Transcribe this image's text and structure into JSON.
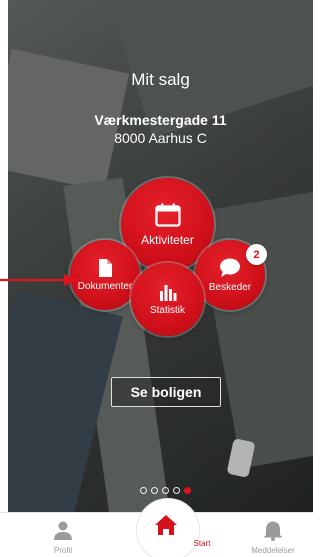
{
  "header": {
    "title": "Mit salg",
    "address": "Værkmestergade 11",
    "city": "8000 Aarhus C"
  },
  "menu": {
    "aktiviteter": {
      "label": "Aktiviteter",
      "icon": "calendar-icon"
    },
    "dokumenter": {
      "label": "Dokumenter",
      "icon": "document-icon"
    },
    "statistik": {
      "label": "Statistik",
      "icon": "bar-chart-icon"
    },
    "beskeder": {
      "label": "Beskeder",
      "icon": "chat-bubble-icon",
      "badge": "2"
    }
  },
  "see_button": {
    "label": "Se boligen"
  },
  "pager": {
    "count": 5,
    "active_index": 4
  },
  "tabbar": {
    "profil": {
      "label": "Profil",
      "icon": "person-icon"
    },
    "start": {
      "label": "Start",
      "icon": "home-icon"
    },
    "meddelelser": {
      "label": "Meddelelser",
      "icon": "bell-icon"
    }
  },
  "colors": {
    "brand_red": "#d5121b",
    "annotation_arrow": "#e0141d",
    "tab_inactive": "#9b9b9b"
  }
}
